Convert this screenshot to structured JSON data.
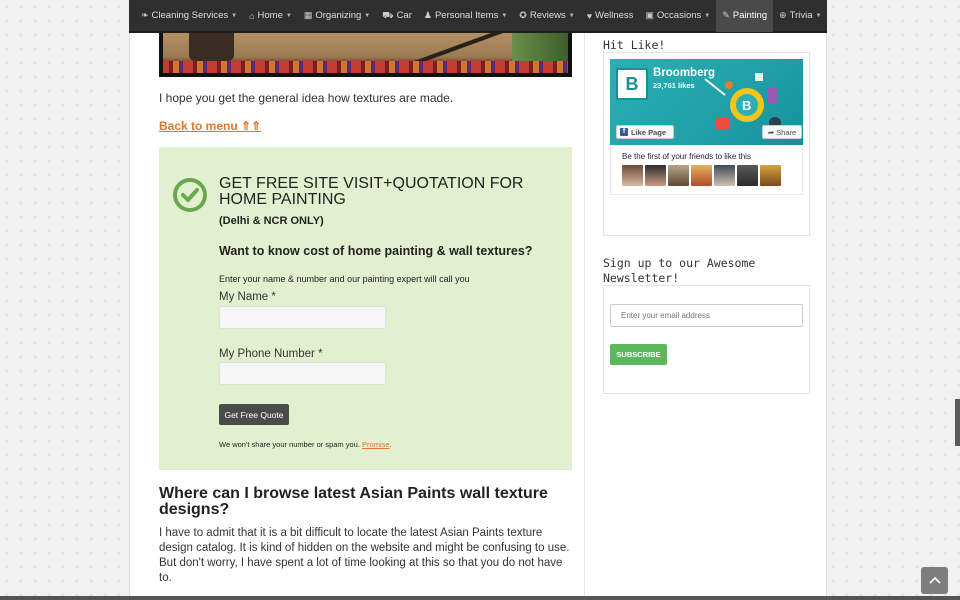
{
  "nav": {
    "items": [
      {
        "icon": "leaf-icon",
        "label": "Cleaning Services",
        "dropdown": true,
        "active": false
      },
      {
        "icon": "home-icon",
        "label": "Home",
        "dropdown": true,
        "active": false
      },
      {
        "icon": "calendar-icon",
        "label": "Organizing",
        "dropdown": true,
        "active": false
      },
      {
        "icon": "car-icon",
        "label": "Car",
        "dropdown": false,
        "active": false
      },
      {
        "icon": "person-icon",
        "label": "Personal Items",
        "dropdown": true,
        "active": false
      },
      {
        "icon": "star-circle-icon",
        "label": "Reviews",
        "dropdown": true,
        "active": false
      },
      {
        "icon": "heartbeat-icon",
        "label": "Wellness",
        "dropdown": false,
        "active": false
      },
      {
        "icon": "gift-icon",
        "label": "Occasions",
        "dropdown": true,
        "active": false
      },
      {
        "icon": "brush-icon",
        "label": "Painting",
        "dropdown": false,
        "active": true
      },
      {
        "icon": "globe-icon",
        "label": "Trivia",
        "dropdown": true,
        "active": false
      }
    ]
  },
  "article": {
    "intro_text": "I hope you get the general idea how textures are made.",
    "back_link": "Back to menu ⇑⇑",
    "heading": "Where can I browse latest Asian Paints wall texture designs?",
    "paragraph": "I have to admit that it is a bit difficult to locate the latest Asian Paints texture design catalog. It is kind of hidden on the website and might be confusing to use. But don't worry, I have spent a lot of time looking at this so that you do not have to."
  },
  "quote_form": {
    "title": "GET FREE SITE VISIT+QUOTATION FOR HOME PAINTING",
    "subtitle": "(Delhi & NCR ONLY)",
    "question": "Want to know cost of home painting & wall textures?",
    "intro": "Enter your name & number and our painting expert will call you",
    "name_label": "My Name *",
    "name_value": "",
    "phone_label": "My Phone Number *",
    "phone_value": "",
    "button": "Get Free Quote",
    "note": "We won't share your number or spam you.",
    "note_link": "Promise",
    "note_end": "."
  },
  "sidebar": {
    "like_title": "Hit Like!",
    "fb": {
      "page_name": "Broomberg",
      "likes": "23,761 likes",
      "like_button": "Like Page",
      "share_button": "Share",
      "friends_text": "Be the first of your friends to like this"
    },
    "newsletter_title": "Sign up to our Awesome Newsletter!",
    "email_placeholder": "Enter your email address",
    "subscribe_button": "SUBSCRIBE"
  },
  "colors": {
    "nav_bg": "#2f2f2f",
    "accent_orange": "#e0762c",
    "quote_bg": "#e3f0d0",
    "check_green": "#6aa84f",
    "subscribe_green": "#5cb85c",
    "fb_teal": "#2ab0b5"
  }
}
